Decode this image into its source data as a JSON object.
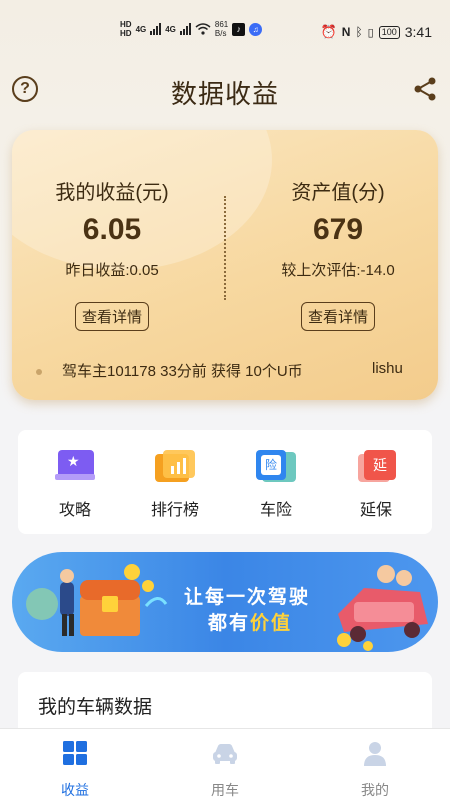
{
  "status_bar": {
    "hd1": "HD",
    "hd2": "HD",
    "net1": "4G",
    "net2": "4G",
    "speed": "861",
    "speed_unit": "B/s",
    "battery": "100",
    "time": "3:41"
  },
  "header": {
    "title": "数据收益",
    "help_icon": "question-circle-icon",
    "share_icon": "share-icon"
  },
  "earnings": {
    "income_label": "我的收益(元)",
    "income_value": "6.05",
    "income_sub": "昨日收益:0.05",
    "income_button": "查看详情",
    "asset_label": "资产值(分)",
    "asset_value": "679",
    "asset_sub": "较上次评估:-14.0",
    "asset_button": "查看详情",
    "ticker_text": "驾车主101178  33分前 获得 10个U币",
    "ticker_text2": "lishu"
  },
  "quick_menu": [
    {
      "label": "攻略",
      "icon": "guide-star-icon",
      "color": "#7d5cf2"
    },
    {
      "label": "排行榜",
      "icon": "ranking-chart-icon",
      "color": "#f5a020"
    },
    {
      "label": "车险",
      "icon": "insurance-icon",
      "color": "#2f86ef",
      "icon_text": "险"
    },
    {
      "label": "延保",
      "icon": "warranty-icon",
      "color": "#f0554a",
      "icon_text": "延"
    }
  ],
  "banner": {
    "line1": "让每一次驾驶",
    "line2_prefix": "都有",
    "line2_highlight": "价值"
  },
  "vehicle_section": {
    "title": "我的车辆数据"
  },
  "bottom_nav": [
    {
      "label": "收益",
      "icon": "grid-icon",
      "active": true
    },
    {
      "label": "用车",
      "icon": "car-icon",
      "active": false
    },
    {
      "label": "我的",
      "icon": "user-icon",
      "active": false
    }
  ],
  "colors": {
    "accent": "#1f6fe0",
    "card_gold": "#f7d8a0",
    "title_brown": "#3b2a14"
  }
}
